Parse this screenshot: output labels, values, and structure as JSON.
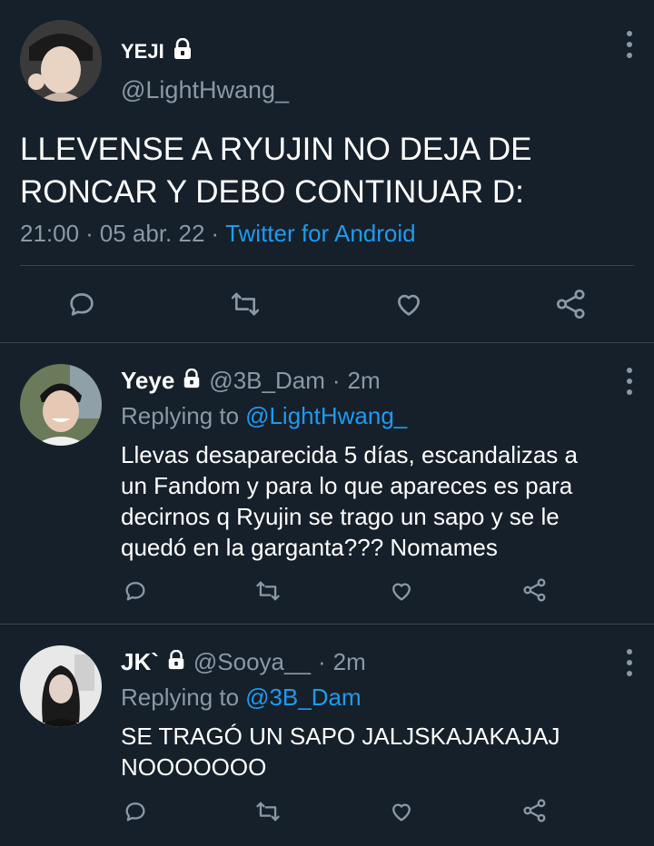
{
  "main_tweet": {
    "display_name": "YEJI",
    "handle": "@LightHwang_",
    "text_line1": "LLEVENSE A RYUJIN NO DEJA DE",
    "text_line2": "RONCAR Y DEBO CONTINUAR D:",
    "time": "21:00",
    "date": "05 abr. 22",
    "source": "Twitter for Android",
    "sep": "·"
  },
  "replies": [
    {
      "display_name": "Yeye",
      "handle": "@3B_Dam",
      "time": "2m",
      "replying_label": "Replying to",
      "replying_to": "@LightHwang_",
      "lines": [
        "Llevas desaparecida 5 días, escandalizas a",
        "un Fandom y para lo que apareces es para",
        "decirnos q Ryujin se trago un sapo y se le",
        "quedó en la garganta??? Nomames"
      ]
    },
    {
      "display_name": "JK`",
      "handle": "@Sooya__",
      "time": "2m",
      "replying_label": "Replying to",
      "replying_to": "@3B_Dam",
      "lines": [
        "SE TRAGÓ UN SAPO JALJSKAJAKAJAJ",
        "NOOOOOOO"
      ]
    }
  ],
  "icons": [
    "reply-icon",
    "retweet-icon",
    "like-icon",
    "share-icon",
    "lock-icon",
    "more-options-icon"
  ],
  "colors": {
    "background": "#15202b",
    "accent": "#1d9bf0",
    "muted": "#8b98a5",
    "divider": "#38444d"
  }
}
